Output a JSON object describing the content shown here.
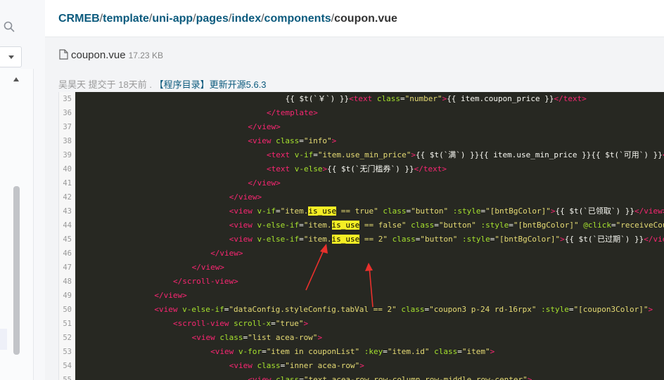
{
  "breadcrumb": {
    "segments": [
      "CRMEB",
      "template",
      "uni-app",
      "pages",
      "index",
      "components"
    ],
    "separator": "/",
    "current": "coupon.vue"
  },
  "file": {
    "name": "coupon.vue",
    "size": "17.23 KB"
  },
  "commit": {
    "author": "吴昊天",
    "action": "提交于",
    "when": "18天前",
    "dot": ".",
    "message": "【程序目录】更新开源5.6.3"
  },
  "colors": {
    "link": "#0b5a7d",
    "tag": "#f92672",
    "attr": "#a6e22e",
    "string": "#e6db74",
    "code_bg": "#272822",
    "highlight": "#f5ee25",
    "annotation_arrow": "#e8302c"
  },
  "code_lines": [
    {
      "n": "35",
      "indent": 11,
      "tokens": [
        {
          "c": "pl",
          "t": "{{ $t(`￥`) }}"
        },
        {
          "c": "tg",
          "t": "<text "
        },
        {
          "c": "at",
          "t": "class"
        },
        {
          "c": "pl",
          "t": "="
        },
        {
          "c": "st",
          "t": "\"number\""
        },
        {
          "c": "tg",
          "t": ">"
        },
        {
          "c": "pl",
          "t": "{{ item.coupon_price }}"
        },
        {
          "c": "tg",
          "t": "</text>"
        }
      ]
    },
    {
      "n": "36",
      "indent": 10,
      "tokens": [
        {
          "c": "tg",
          "t": "</template>"
        }
      ]
    },
    {
      "n": "37",
      "indent": 9,
      "tokens": [
        {
          "c": "tg",
          "t": "</view>"
        }
      ]
    },
    {
      "n": "38",
      "indent": 9,
      "tokens": [
        {
          "c": "tg",
          "t": "<view "
        },
        {
          "c": "at",
          "t": "class"
        },
        {
          "c": "pl",
          "t": "="
        },
        {
          "c": "st",
          "t": "\"info\""
        },
        {
          "c": "tg",
          "t": ">"
        }
      ]
    },
    {
      "n": "39",
      "indent": 10,
      "tokens": [
        {
          "c": "tg",
          "t": "<text "
        },
        {
          "c": "at",
          "t": "v-if"
        },
        {
          "c": "pl",
          "t": "="
        },
        {
          "c": "st",
          "t": "\"item.use_min_price\""
        },
        {
          "c": "tg",
          "t": ">"
        },
        {
          "c": "pl",
          "t": "{{ $t(`满`) }}{{ item.use_min_price }}{{ $t(`可用`) }}"
        },
        {
          "c": "tg",
          "t": "</text>"
        }
      ]
    },
    {
      "n": "40",
      "indent": 10,
      "tokens": [
        {
          "c": "tg",
          "t": "<text "
        },
        {
          "c": "at",
          "t": "v-else"
        },
        {
          "c": "tg",
          "t": ">"
        },
        {
          "c": "pl",
          "t": "{{ $t(`无门槛券`) }}"
        },
        {
          "c": "tg",
          "t": "</text>"
        }
      ]
    },
    {
      "n": "41",
      "indent": 9,
      "tokens": [
        {
          "c": "tg",
          "t": "</view>"
        }
      ]
    },
    {
      "n": "42",
      "indent": 8,
      "tokens": [
        {
          "c": "tg",
          "t": "</view>"
        }
      ]
    },
    {
      "n": "43",
      "indent": 8,
      "tokens": [
        {
          "c": "tg",
          "t": "<view "
        },
        {
          "c": "at",
          "t": "v-if"
        },
        {
          "c": "pl",
          "t": "="
        },
        {
          "c": "st",
          "t": "\"item."
        },
        {
          "c": "hl",
          "t": "is_use"
        },
        {
          "c": "st",
          "t": " == true\""
        },
        {
          "c": "pl",
          "t": " "
        },
        {
          "c": "at",
          "t": "class"
        },
        {
          "c": "pl",
          "t": "="
        },
        {
          "c": "st",
          "t": "\"button\""
        },
        {
          "c": "pl",
          "t": " "
        },
        {
          "c": "at",
          "t": ":style"
        },
        {
          "c": "pl",
          "t": "="
        },
        {
          "c": "st",
          "t": "\"[bntBgColor]\""
        },
        {
          "c": "tg",
          "t": ">"
        },
        {
          "c": "pl",
          "t": "{{ $t(`已领取`) }}"
        },
        {
          "c": "tg",
          "t": "</view>"
        }
      ]
    },
    {
      "n": "44",
      "indent": 8,
      "tokens": [
        {
          "c": "tg",
          "t": "<view "
        },
        {
          "c": "at",
          "t": "v-else-if"
        },
        {
          "c": "pl",
          "t": "="
        },
        {
          "c": "st",
          "t": "\"item."
        },
        {
          "c": "hl",
          "t": "is_use"
        },
        {
          "c": "st",
          "t": " == false\""
        },
        {
          "c": "pl",
          "t": " "
        },
        {
          "c": "at",
          "t": "class"
        },
        {
          "c": "pl",
          "t": "="
        },
        {
          "c": "st",
          "t": "\"button\""
        },
        {
          "c": "pl",
          "t": " "
        },
        {
          "c": "at",
          "t": ":style"
        },
        {
          "c": "pl",
          "t": "="
        },
        {
          "c": "st",
          "t": "\"[bntBgColor]\""
        },
        {
          "c": "pl",
          "t": " "
        },
        {
          "c": "at",
          "t": "@click"
        },
        {
          "c": "pl",
          "t": "="
        },
        {
          "c": "st",
          "t": "\"receiveCoupon(item)\""
        }
      ]
    },
    {
      "n": "45",
      "indent": 8,
      "tokens": [
        {
          "c": "tg",
          "t": "<view "
        },
        {
          "c": "at",
          "t": "v-else-if"
        },
        {
          "c": "pl",
          "t": "="
        },
        {
          "c": "st",
          "t": "\"item."
        },
        {
          "c": "hl",
          "t": "is_use"
        },
        {
          "c": "st",
          "t": " == 2\""
        },
        {
          "c": "pl",
          "t": " "
        },
        {
          "c": "at",
          "t": "class"
        },
        {
          "c": "pl",
          "t": "="
        },
        {
          "c": "st",
          "t": "\"button\""
        },
        {
          "c": "pl",
          "t": " "
        },
        {
          "c": "at",
          "t": ":style"
        },
        {
          "c": "pl",
          "t": "="
        },
        {
          "c": "st",
          "t": "\"[bntBgColor]\""
        },
        {
          "c": "tg",
          "t": ">"
        },
        {
          "c": "pl",
          "t": "{{ $t(`已过期`) }}"
        },
        {
          "c": "tg",
          "t": "</view>"
        }
      ]
    },
    {
      "n": "46",
      "indent": 7,
      "tokens": [
        {
          "c": "tg",
          "t": "</view>"
        }
      ]
    },
    {
      "n": "47",
      "indent": 6,
      "tokens": [
        {
          "c": "tg",
          "t": "</view>"
        }
      ]
    },
    {
      "n": "48",
      "indent": 5,
      "tokens": [
        {
          "c": "tg",
          "t": "</scroll-view>"
        }
      ]
    },
    {
      "n": "49",
      "indent": 4,
      "tokens": [
        {
          "c": "tg",
          "t": "</view>"
        }
      ]
    },
    {
      "n": "50",
      "indent": 4,
      "tokens": [
        {
          "c": "tg",
          "t": "<view "
        },
        {
          "c": "at",
          "t": "v-else-if"
        },
        {
          "c": "pl",
          "t": "="
        },
        {
          "c": "st",
          "t": "\"dataConfig.styleConfig.tabVal == 2\""
        },
        {
          "c": "pl",
          "t": " "
        },
        {
          "c": "at",
          "t": "class"
        },
        {
          "c": "pl",
          "t": "="
        },
        {
          "c": "st",
          "t": "\"coupon3 p-24 rd-16rpx\""
        },
        {
          "c": "pl",
          "t": " "
        },
        {
          "c": "at",
          "t": ":style"
        },
        {
          "c": "pl",
          "t": "="
        },
        {
          "c": "st",
          "t": "\"[coupon3Color]\""
        },
        {
          "c": "tg",
          "t": ">"
        }
      ]
    },
    {
      "n": "51",
      "indent": 5,
      "tokens": [
        {
          "c": "tg",
          "t": "<scroll-view "
        },
        {
          "c": "at",
          "t": "scroll-x"
        },
        {
          "c": "pl",
          "t": "="
        },
        {
          "c": "st",
          "t": "\"true\""
        },
        {
          "c": "tg",
          "t": ">"
        }
      ]
    },
    {
      "n": "52",
      "indent": 6,
      "tokens": [
        {
          "c": "tg",
          "t": "<view "
        },
        {
          "c": "at",
          "t": "class"
        },
        {
          "c": "pl",
          "t": "="
        },
        {
          "c": "st",
          "t": "\"list acea-row\""
        },
        {
          "c": "tg",
          "t": ">"
        }
      ]
    },
    {
      "n": "53",
      "indent": 7,
      "tokens": [
        {
          "c": "tg",
          "t": "<view "
        },
        {
          "c": "at",
          "t": "v-for"
        },
        {
          "c": "pl",
          "t": "="
        },
        {
          "c": "st",
          "t": "\"item in couponList\""
        },
        {
          "c": "pl",
          "t": " "
        },
        {
          "c": "at",
          "t": ":key"
        },
        {
          "c": "pl",
          "t": "="
        },
        {
          "c": "st",
          "t": "\"item.id\""
        },
        {
          "c": "pl",
          "t": " "
        },
        {
          "c": "at",
          "t": "class"
        },
        {
          "c": "pl",
          "t": "="
        },
        {
          "c": "st",
          "t": "\"item\""
        },
        {
          "c": "tg",
          "t": ">"
        }
      ]
    },
    {
      "n": "54",
      "indent": 8,
      "tokens": [
        {
          "c": "tg",
          "t": "<view "
        },
        {
          "c": "at",
          "t": "class"
        },
        {
          "c": "pl",
          "t": "="
        },
        {
          "c": "st",
          "t": "\"inner acea-row\""
        },
        {
          "c": "tg",
          "t": ">"
        }
      ]
    },
    {
      "n": "55",
      "indent": 9,
      "tokens": [
        {
          "c": "tg",
          "t": "<view "
        },
        {
          "c": "at",
          "t": "class"
        },
        {
          "c": "pl",
          "t": "="
        },
        {
          "c": "st",
          "t": "\"text acea-row row-column row-middle row-center\""
        },
        {
          "c": "tg",
          "t": ">"
        }
      ]
    }
  ]
}
